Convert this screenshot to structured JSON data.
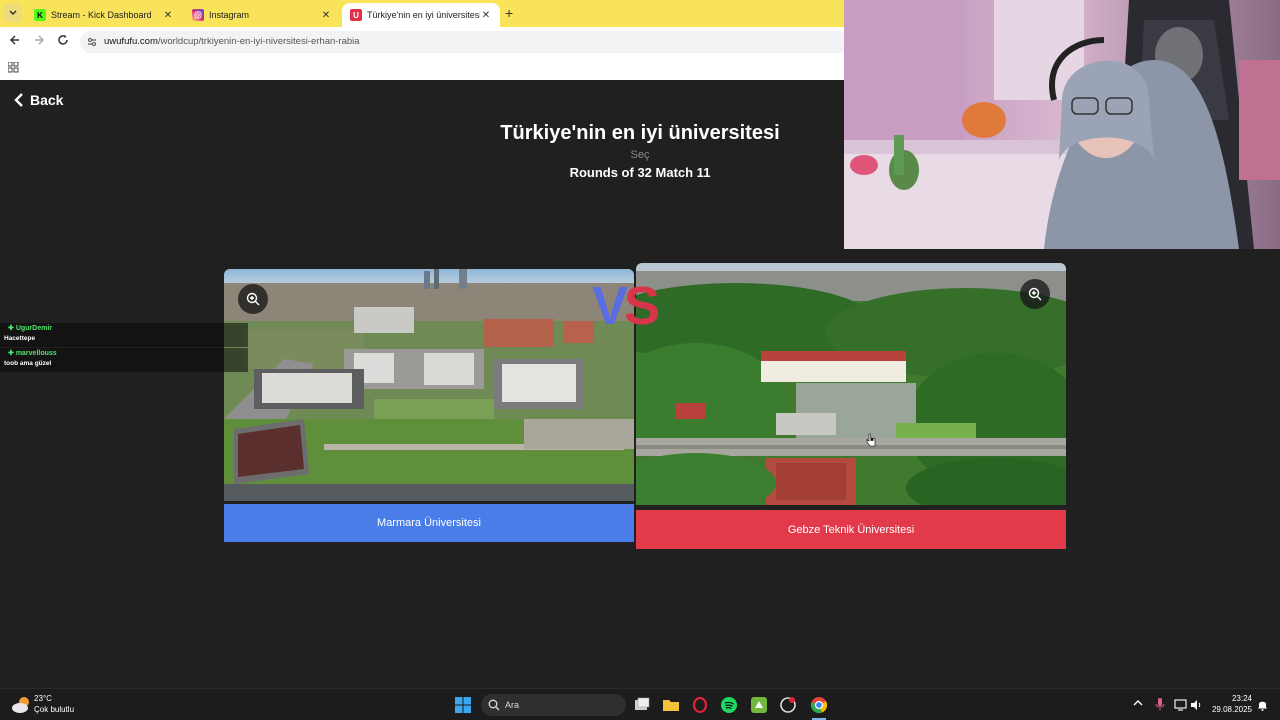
{
  "browser": {
    "tabs": [
      {
        "label": "Stream - Kick Dashboard",
        "favicon": "kick-icon",
        "favicon_color": "#53fc18"
      },
      {
        "label": "Instagram",
        "favicon": "instagram-icon",
        "favicon_color": "#d62976"
      },
      {
        "label": "Türkiye'nin en iyi üniversitesi | U",
        "favicon": "uwufufu-icon",
        "favicon_color": "#e0304a",
        "active": true
      }
    ],
    "url_domain": "uwufufu.com",
    "url_path": "/worldcup/trkiyenin-en-iyi-niversitesi-erhan-rabia"
  },
  "page": {
    "back_label": "Back",
    "title": "Türkiye'nin en iyi üniversitesi",
    "subtitle": "Seç",
    "round": "Rounds of 32 Match 11",
    "vs_v": "V",
    "vs_s": "S",
    "left_choice": "Marmara Üniversitesi",
    "right_choice": "Gebze Teknik Üniversitesi"
  },
  "chat": [
    {
      "user": "UgurDemir",
      "message": "Hacettepe"
    },
    {
      "user": "marvellouss",
      "message": "toob ama güzel"
    }
  ],
  "taskbar": {
    "temperature": "23°C",
    "weather": "Çok bulutlu",
    "search_placeholder": "Ara",
    "time": "23:24",
    "date": "29.08.2025"
  },
  "colors": {
    "left_button": "#4a7de8",
    "right_button": "#e23a4a",
    "tab_bar": "#f8e35a",
    "chat_name": "#4ee66a"
  }
}
